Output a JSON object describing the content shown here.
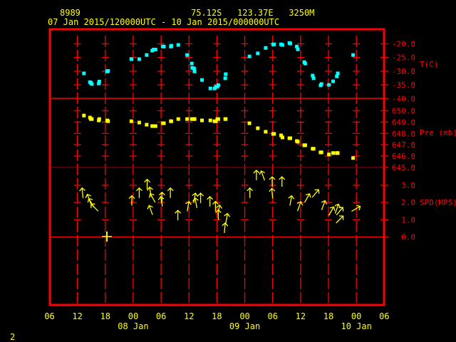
{
  "header": {
    "station": "8989",
    "location": "75.12S   123.37E   3250M",
    "period": "07 Jan 2015/120000UTC - 10 Jan 2015/000000UTC"
  },
  "footer_number": "2",
  "colors": {
    "frame": "#ff0000",
    "temperature": "#00ffff",
    "pressure": "#ffff00",
    "wind": "#ffff00",
    "text": "#ffff00"
  },
  "chart_data": [
    {
      "type": "scatter",
      "title": "Temperature",
      "ylabel": "T(C)",
      "xunit": "hours since 07 Jan 2015 00UTC",
      "xlim": [
        6,
        78
      ],
      "ylim": [
        -40,
        -20
      ],
      "yticks": [
        "-20.0",
        "-25.0",
        "-30.0",
        "-35.0",
        "-40.0"
      ],
      "x": [
        13.4,
        14.7,
        14.9,
        15.1,
        16.6,
        16.7,
        18.4,
        18.6,
        23.6,
        25.3,
        26.9,
        28.1,
        28.4,
        28.8,
        30.4,
        30.6,
        32.1,
        32.2,
        33.7,
        35.6,
        36.6,
        36.7,
        37.1,
        37.2,
        38.8,
        40.6,
        41.5,
        41.8,
        42.1,
        42.3,
        43.8,
        43.9,
        49.0,
        50.8,
        52.5,
        54.1,
        54.3,
        55.8,
        56.1,
        57.6,
        57.8,
        59.2,
        59.4,
        60.8,
        61.0,
        62.6,
        62.8,
        64.3,
        64.5,
        66.1,
        67.0,
        67.8,
        68.0,
        71.3
      ],
      "y": [
        -30.8,
        -34.0,
        -34.3,
        -34.7,
        -34.5,
        -33.8,
        -30.1,
        -29.9,
        -25.6,
        -25.6,
        -24.1,
        -22.5,
        -22.1,
        -22.1,
        -21.0,
        -21.0,
        -21.0,
        -20.7,
        -20.4,
        -24.1,
        -27.2,
        -28.8,
        -29.0,
        -30.1,
        -33.2,
        -36.3,
        -36.3,
        -35.7,
        -35.7,
        -35.1,
        -32.6,
        -31.1,
        -24.6,
        -23.5,
        -21.5,
        -20.2,
        -20.2,
        -20.2,
        -20.4,
        -19.7,
        -19.9,
        -21.0,
        -22.0,
        -26.7,
        -27.2,
        -31.6,
        -32.6,
        -35.2,
        -34.7,
        -35.0,
        -33.7,
        -31.9,
        -30.8,
        -24.1
      ]
    },
    {
      "type": "scatter",
      "title": "Pressure",
      "ylabel": "Pre (mb)",
      "xunit": "hours since 07 Jan 2015 00UTC",
      "xlim": [
        6,
        78
      ],
      "ylim": [
        645,
        650
      ],
      "yticks": [
        "650.0",
        "649.0",
        "648.0",
        "647.0",
        "646.0",
        "645.0"
      ],
      "x": [
        13.4,
        14.7,
        14.9,
        15.1,
        16.6,
        16.7,
        18.4,
        18.6,
        23.6,
        25.3,
        26.9,
        28.1,
        28.4,
        28.8,
        30.4,
        30.6,
        32.1,
        32.2,
        33.7,
        35.6,
        36.6,
        36.7,
        37.1,
        37.2,
        38.8,
        40.6,
        41.5,
        41.8,
        42.1,
        42.3,
        43.8,
        43.9,
        49.0,
        50.8,
        52.5,
        54.1,
        54.3,
        55.8,
        56.1,
        57.6,
        57.8,
        59.2,
        59.4,
        60.8,
        61.0,
        62.6,
        62.8,
        64.3,
        64.5,
        66.1,
        67.0,
        67.8,
        68.0,
        71.3
      ],
      "y": [
        649.58,
        649.4,
        649.27,
        649.27,
        649.15,
        649.27,
        649.15,
        649.08,
        649.08,
        648.96,
        648.77,
        648.65,
        648.65,
        648.65,
        648.9,
        648.9,
        649.08,
        649.08,
        649.27,
        649.27,
        649.27,
        649.27,
        649.27,
        649.27,
        649.15,
        649.15,
        649.08,
        649.08,
        649.27,
        649.27,
        649.27,
        649.27,
        648.9,
        648.46,
        648.15,
        647.96,
        647.96,
        647.83,
        647.65,
        647.58,
        647.58,
        647.33,
        647.27,
        646.96,
        646.96,
        646.65,
        646.65,
        646.33,
        646.33,
        646.15,
        646.27,
        646.27,
        646.27,
        645.83
      ]
    },
    {
      "type": "scatter",
      "title": "Wind speed and direction (arrows)",
      "ylabel": "SPD(MPS)",
      "xunit": "hours since 07 Jan 2015 00UTC",
      "xlim": [
        6,
        78
      ],
      "ylim": [
        0,
        4
      ],
      "yticks": [
        "3.0",
        "2.0",
        "1.0",
        "0.0"
      ],
      "x": [
        13.1,
        14.5,
        15.0,
        15.7,
        23.7,
        25.3,
        27.0,
        27.7,
        28.2,
        27.8,
        32.0,
        30.2,
        30.1,
        33.6,
        35.8,
        37.2,
        37.5,
        38.5,
        40.5,
        41.7,
        42.4,
        42.3,
        44.1,
        43.7,
        49.1,
        50.5,
        51.9,
        53.9,
        53.9,
        56.0,
        57.9,
        59.7,
        61.4,
        63.2,
        64.9,
        66.6,
        67.8,
        68.4,
        68.4,
        71.9
      ],
      "speed": [
        2.55,
        2.2,
        1.97,
        1.7,
        2.1,
        2.55,
        3.05,
        2.6,
        2.25,
        1.55,
        2.55,
        2.3,
        2.05,
        1.25,
        1.77,
        2.25,
        1.97,
        2.25,
        2.05,
        1.77,
        1.56,
        1.28,
        1.07,
        0.52,
        2.55,
        3.58,
        3.55,
        3.2,
        2.52,
        3.2,
        2.1,
        1.77,
        2.25,
        2.52,
        1.83,
        1.49,
        1.63,
        1.49,
        1.01,
        1.63
      ],
      "arrow_direction_deg": [
        -5,
        -20,
        -30,
        -45,
        0,
        0,
        0,
        -10,
        -30,
        -20,
        0,
        0,
        -10,
        0,
        10,
        10,
        -10,
        0,
        0,
        0,
        10,
        0,
        10,
        5,
        0,
        0,
        -20,
        0,
        -5,
        0,
        10,
        20,
        30,
        40,
        20,
        30,
        20,
        40,
        45,
        60
      ]
    }
  ],
  "x_axis": {
    "hour_labels": [
      "06",
      "12",
      "18",
      "00",
      "06",
      "12",
      "18",
      "00",
      "06",
      "12",
      "18",
      "00",
      "06"
    ],
    "date_labels": [
      "08 Jan",
      "09 Jan",
      "10 Jan"
    ]
  }
}
